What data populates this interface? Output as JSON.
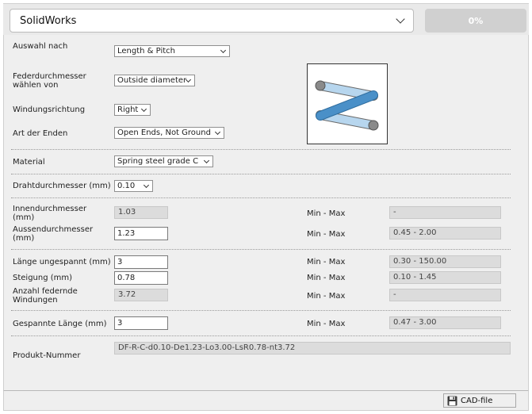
{
  "header": {
    "cad_system": "SolidWorks",
    "progress_label": "0%",
    "progress_value": 0
  },
  "form": {
    "auswahl": {
      "label": "Auswahl nach",
      "value": "Length & Pitch"
    },
    "feder": {
      "label_l1": "Federdurchmesser",
      "label_l2": "wählen von",
      "value": "Outside diameter"
    },
    "windung": {
      "label": "Windungsrichtung",
      "value": "Right"
    },
    "enden": {
      "label": "Art der Enden",
      "value": "Open Ends, Not Ground"
    },
    "material": {
      "label": "Material",
      "value": "Spring steel grade C"
    },
    "draht": {
      "label": "Drahtdurchmesser (mm)",
      "value": "0.10"
    },
    "innen": {
      "label_l1": "Innendurchmesser",
      "label_l2": "(mm)",
      "value": "1.03",
      "minmax_label": "Min - Max",
      "minmax": "-"
    },
    "aussen": {
      "label_l1": "Aussendurchmesser",
      "label_l2": "(mm)",
      "value": "1.23",
      "minmax_label": "Min - Max",
      "minmax": "0.45 - 2.00"
    },
    "laenge": {
      "label": "Länge ungespannt (mm)",
      "value": "3",
      "minmax_label": "Min - Max",
      "minmax": "0.30 - 150.00"
    },
    "steigung": {
      "label": "Steigung (mm)",
      "value": "0.78",
      "minmax_label": "Min - Max",
      "minmax": "0.10 - 1.45"
    },
    "anzahl": {
      "label_l1": "Anzahl federnde",
      "label_l2": "Windungen",
      "value": "3.72",
      "minmax_label": "Min - Max",
      "minmax": "-"
    },
    "gespannt": {
      "label": "Gespannte Länge (mm)",
      "value": "3",
      "minmax_label": "Min - Max",
      "minmax": "0.47 - 3.00"
    },
    "produkt": {
      "label": "Produkt-Nummer",
      "value": "DF-R-C-d0.10-De1.23-Lo3.00-LsR0.78-nt3.72"
    }
  },
  "footer": {
    "cad_file_label": "CAD-file"
  },
  "colors": {
    "spring_front": "#4a90c8",
    "spring_back": "#b7d6ee",
    "progress_fill": "#4a8fc6"
  },
  "icons": {
    "spring": "compression-spring-icon",
    "cad_file": "floppy-disk-icon"
  }
}
